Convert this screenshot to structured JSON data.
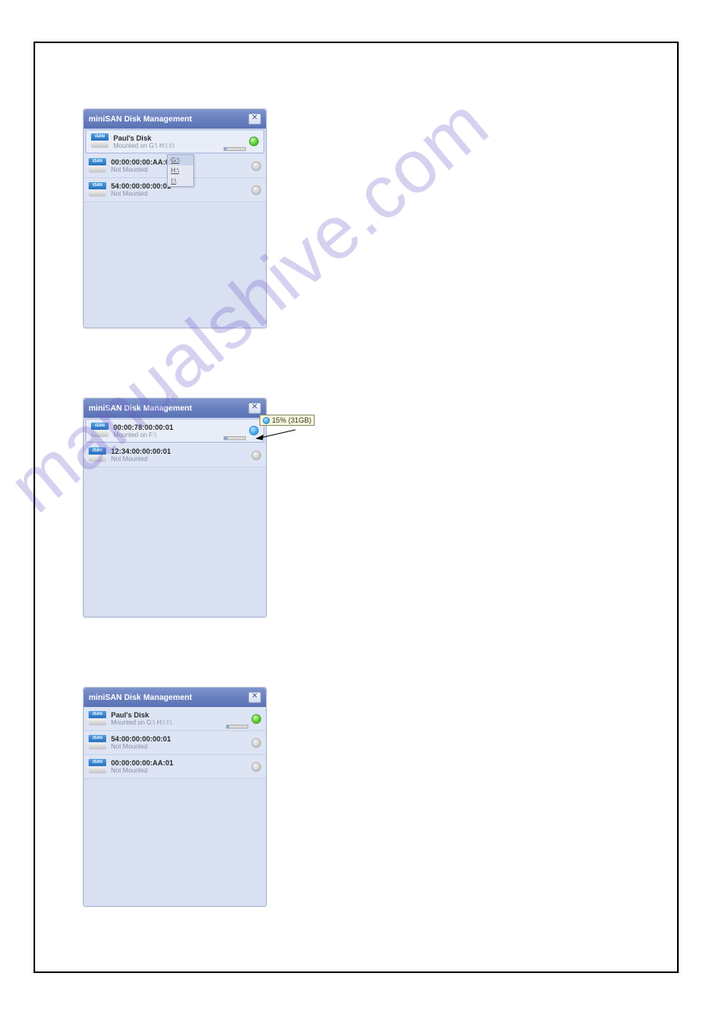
{
  "watermark": "manualshive.com",
  "panels": {
    "p1": {
      "title": "miniSAN Disk Management",
      "rows": [
        {
          "title": "Paul's Disk",
          "sub": "Mounted on G:\\ H:\\ I:\\",
          "dot": "green",
          "selected": true,
          "bar": true,
          "barFill": 12
        },
        {
          "title": "00:00:00:00:AA:01",
          "sub": "Not Mounted",
          "dot": "grey"
        },
        {
          "title": "54:00:00:00:00:01",
          "sub": "Not Mounted",
          "dot": "grey"
        }
      ],
      "dropdown": [
        "G:\\",
        "H:\\",
        "I:\\"
      ]
    },
    "p2": {
      "title": "miniSAN Disk Management",
      "rows": [
        {
          "title": "00:00:78:00:00:01",
          "sub": "Mounted on F:\\",
          "dot": "blue",
          "selected": true,
          "bar": true,
          "barFill": 15
        },
        {
          "title": "12:34:00:00:00:01",
          "sub": "Not Mounted",
          "dot": "grey"
        }
      ],
      "tooltip": "15% (31GB)"
    },
    "p3": {
      "title": "miniSAN Disk Management",
      "rows": [
        {
          "title": "Paul's Disk",
          "sub": "Mounted on G:\\ H:\\ I:\\",
          "dot": "green",
          "bar": true,
          "barFill": 12
        },
        {
          "title": "54:00:00:00:00:01",
          "sub": "Not Mounted",
          "dot": "grey"
        },
        {
          "title": "00:00:00:00:AA:01",
          "sub": "Not Mounted",
          "dot": "grey"
        }
      ]
    }
  },
  "close": "✕"
}
